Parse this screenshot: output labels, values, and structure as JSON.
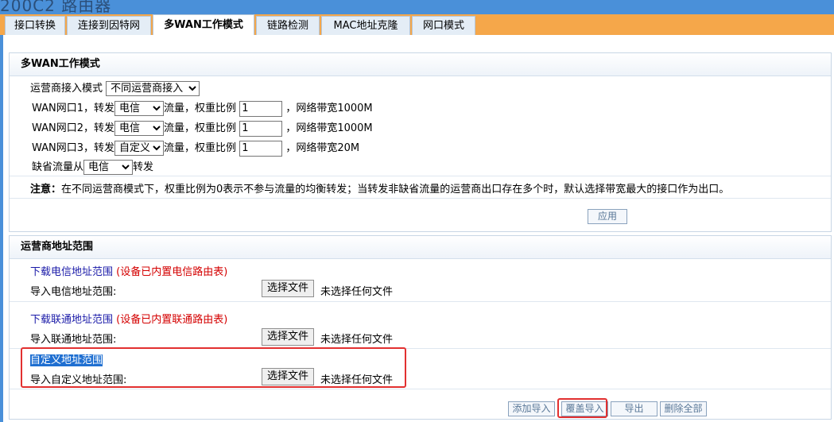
{
  "window": {
    "title": "200C2 路由器"
  },
  "tabs": [
    {
      "label": "接口转换"
    },
    {
      "label": "连接到因特网"
    },
    {
      "label": "多WAN工作模式"
    },
    {
      "label": "链路检测"
    },
    {
      "label": "MAC地址克隆"
    },
    {
      "label": "网口模式"
    }
  ],
  "multiwan": {
    "heading": "多WAN工作模式",
    "isp_mode_label": "运营商接入模式",
    "isp_mode_value": "不同运营商接入",
    "wan_rows": [
      {
        "prefix": "WAN网口1，转发",
        "isp": "电信",
        "mid": "流量，权重比例",
        "weight": "1",
        "suffix": "，网络带宽1000M"
      },
      {
        "prefix": "WAN网口2，转发",
        "isp": "电信",
        "mid": "流量，权重比例",
        "weight": "1",
        "suffix": "，网络带宽1000M"
      },
      {
        "prefix": "WAN网口3，转发",
        "isp": "自定义",
        "mid": "流量，权重比例",
        "weight": "1",
        "suffix": "，网络带宽20M"
      }
    ],
    "default_prefix": "缺省流量从",
    "default_isp": "电信",
    "default_suffix": "转发",
    "note_label": "注意：",
    "note_text": "在不同运营商模式下，权重比例为0表示不参与流量的均衡转发；当转发非缺省流量的运营商出口存在多个时，默认选择带宽最大的接口作为出口。",
    "apply_label": "应用"
  },
  "ranges": {
    "heading": "运营商地址范围",
    "telecom": {
      "link": "下载电信地址范围",
      "hint": "(设备已内置电信路由表)",
      "import_label": "导入电信地址范围:",
      "file_button": "选择文件",
      "file_status": "未选择任何文件"
    },
    "unicom": {
      "link": "下载联通地址范围",
      "hint": "(设备已内置联通路由表)",
      "import_label": "导入联通地址范围:",
      "file_button": "选择文件",
      "file_status": "未选择任何文件"
    },
    "custom": {
      "link": "自定义地址范围",
      "import_label": "导入自定义地址范围:",
      "file_button": "选择文件",
      "file_status": "未选择任何文件"
    },
    "actions": {
      "add_import": "添加导入",
      "overwrite_import": "覆盖导入",
      "export": "导出",
      "delete_all": "删除全部"
    }
  },
  "colors": {
    "tabbar": "#f5a74a",
    "topbar": "#4a90d9",
    "highlight_box": "#e23030"
  }
}
